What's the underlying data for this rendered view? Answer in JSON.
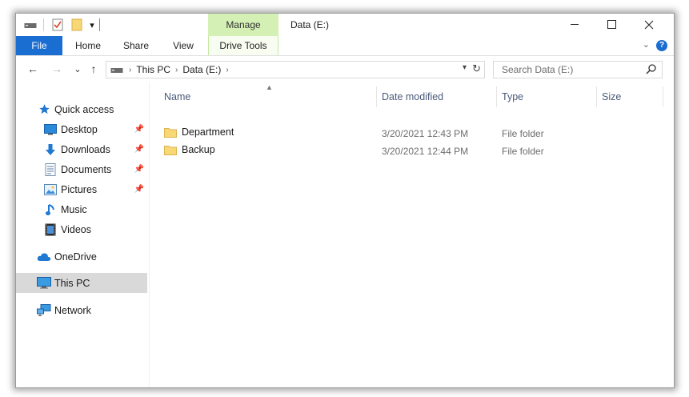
{
  "window": {
    "title": "Data (E:)",
    "context_tab": "Manage",
    "controls": {
      "minimize": "—",
      "maximize": "☐",
      "close": "✕"
    }
  },
  "ribbon": {
    "tabs": [
      {
        "label": "File"
      },
      {
        "label": "Home"
      },
      {
        "label": "Share"
      },
      {
        "label": "View"
      },
      {
        "label": "Drive Tools"
      }
    ],
    "help": "?",
    "collapse": "⌄"
  },
  "nav": {
    "back": "←",
    "forward": "→",
    "recent": "⌄",
    "up": "↑",
    "breadcrumb": [
      "This PC",
      "Data (E:)"
    ],
    "search_placeholder": "Search Data (E:)"
  },
  "sidebar": {
    "items": [
      {
        "label": "Quick access",
        "icon": "star-icon"
      },
      {
        "label": "Desktop",
        "icon": "desktop-icon",
        "pinned": true
      },
      {
        "label": "Downloads",
        "icon": "download-icon",
        "pinned": true
      },
      {
        "label": "Documents",
        "icon": "documents-icon",
        "pinned": true
      },
      {
        "label": "Pictures",
        "icon": "pictures-icon",
        "pinned": true
      },
      {
        "label": "Music",
        "icon": "music-icon"
      },
      {
        "label": "Videos",
        "icon": "videos-icon"
      },
      {
        "label": "OneDrive",
        "icon": "cloud-icon"
      },
      {
        "label": "This PC",
        "icon": "computer-icon",
        "selected": true
      },
      {
        "label": "Network",
        "icon": "network-icon"
      }
    ]
  },
  "table": {
    "columns": [
      "Name",
      "Date modified",
      "Type",
      "Size"
    ],
    "rows": [
      {
        "name": "Department",
        "date": "3/20/2021 12:43 PM",
        "type": "File folder",
        "size": ""
      },
      {
        "name": "Backup",
        "date": "3/20/2021 12:44 PM",
        "type": "File folder",
        "size": ""
      }
    ]
  },
  "colors": {
    "accent": "#1a6dd1",
    "manage_tab": "#d5f0b5",
    "folder": "#f8d775",
    "selected": "#d9d9d9"
  }
}
